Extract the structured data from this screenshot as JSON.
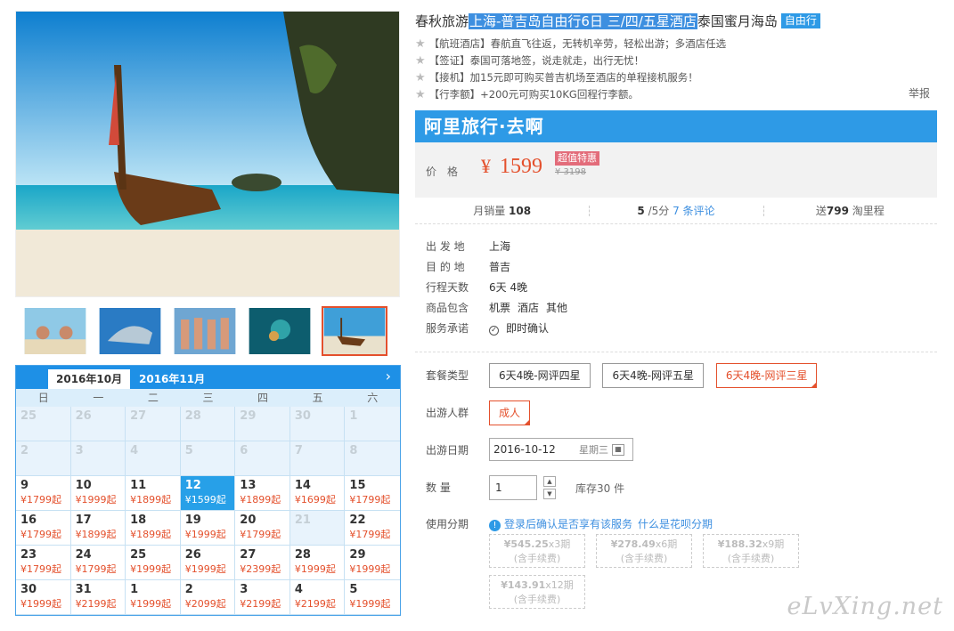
{
  "title": {
    "prefix": "春秋旅游",
    "highlight": "上海-普吉岛自由行6日 三/四/五星酒店",
    "suffix": "泰国蜜月海岛",
    "tag": "自由行"
  },
  "features": [
    "【航班酒店】春航直飞往返，无转机辛劳，轻松出游；多酒店任选",
    "【签证】泰国可落地签，说走就走，出行无忧！",
    "【接机】加15元即可购买普吉机场至酒店的单程接机服务！",
    "【行李额】+200元可购买10KG回程行李额。"
  ],
  "report_label": "举报",
  "brand": "阿里旅行·去啊",
  "price": {
    "label": "价格",
    "currency": "¥",
    "value": "1599",
    "badge": "超值特惠",
    "original": "¥ 3198"
  },
  "stats": {
    "sales_label": "月销量",
    "sales_value": "108",
    "rating_value": "5",
    "rating_suffix": "/5分",
    "reviews_link": "7 条评论",
    "miles_prefix": "送",
    "miles_value": "799",
    "miles_suffix": "淘里程"
  },
  "info": [
    {
      "key": "出 发 地",
      "value": "上海"
    },
    {
      "key": "目 的 地",
      "value": "普吉"
    },
    {
      "key": "行程天数",
      "value": "6天 4晚"
    },
    {
      "key": "商品包含",
      "values": [
        "机票",
        "酒店",
        "其他"
      ]
    },
    {
      "key": "服务承诺",
      "value": "即时确认"
    }
  ],
  "options": {
    "package_label": "套餐类型",
    "packages": [
      "6天4晚-网评四星",
      "6天4晚-网评五星",
      "6天4晚-网评三星"
    ],
    "traveler_label": "出游人群",
    "traveler": "成人",
    "date_label": "出游日期",
    "date_value": "2016-10-12",
    "date_weekday": "星期三",
    "qty_label": "数 量",
    "qty_value": "1",
    "stock": "库存30 件",
    "installment_label": "使用分期",
    "installment_note": "登录后确认是否享有该服务",
    "installment_link": "什么是花呗分期",
    "installments": [
      {
        "amount": "¥545.25",
        "period": "x3期",
        "fee": "(含手续费)"
      },
      {
        "amount": "¥278.49",
        "period": "x6期",
        "fee": "(含手续费)"
      },
      {
        "amount": "¥188.32",
        "period": "x9期",
        "fee": "(含手续费)"
      },
      {
        "amount": "¥143.91",
        "period": "x12期",
        "fee": "(含手续费)"
      }
    ]
  },
  "calendar": {
    "tab_active": "2016年10月",
    "tab_other": "2016年11月",
    "weekdays": [
      "日",
      "一",
      "二",
      "三",
      "四",
      "五",
      "六"
    ],
    "cells": [
      {
        "d": "25",
        "p": "",
        "muted": true
      },
      {
        "d": "26",
        "p": "",
        "muted": true
      },
      {
        "d": "27",
        "p": "",
        "muted": true
      },
      {
        "d": "28",
        "p": "",
        "muted": true
      },
      {
        "d": "29",
        "p": "",
        "muted": true
      },
      {
        "d": "30",
        "p": "",
        "muted": true
      },
      {
        "d": "1",
        "p": "",
        "muted": true
      },
      {
        "d": "2",
        "p": "",
        "muted": true
      },
      {
        "d": "3",
        "p": "",
        "muted": true
      },
      {
        "d": "4",
        "p": "",
        "muted": true
      },
      {
        "d": "5",
        "p": "",
        "muted": true
      },
      {
        "d": "6",
        "p": "",
        "muted": true
      },
      {
        "d": "7",
        "p": "",
        "muted": true
      },
      {
        "d": "8",
        "p": "",
        "muted": true
      },
      {
        "d": "9",
        "p": "¥1799起"
      },
      {
        "d": "10",
        "p": "¥1999起"
      },
      {
        "d": "11",
        "p": "¥1899起"
      },
      {
        "d": "12",
        "p": "¥1599起",
        "sel": true
      },
      {
        "d": "13",
        "p": "¥1899起"
      },
      {
        "d": "14",
        "p": "¥1699起"
      },
      {
        "d": "15",
        "p": "¥1799起"
      },
      {
        "d": "16",
        "p": "¥1799起"
      },
      {
        "d": "17",
        "p": "¥1899起"
      },
      {
        "d": "18",
        "p": "¥1899起"
      },
      {
        "d": "19",
        "p": "¥1999起"
      },
      {
        "d": "20",
        "p": "¥1799起"
      },
      {
        "d": "21",
        "p": "",
        "muted": true
      },
      {
        "d": "22",
        "p": "¥1799起"
      },
      {
        "d": "23",
        "p": "¥1799起"
      },
      {
        "d": "24",
        "p": "¥1799起"
      },
      {
        "d": "25",
        "p": "¥1999起"
      },
      {
        "d": "26",
        "p": "¥1999起"
      },
      {
        "d": "27",
        "p": "¥2399起"
      },
      {
        "d": "28",
        "p": "¥1999起"
      },
      {
        "d": "29",
        "p": "¥1999起"
      },
      {
        "d": "30",
        "p": "¥1999起"
      },
      {
        "d": "31",
        "p": "¥2199起"
      },
      {
        "d": "1",
        "p": "¥1999起"
      },
      {
        "d": "2",
        "p": "¥2099起"
      },
      {
        "d": "3",
        "p": "¥2199起"
      },
      {
        "d": "4",
        "p": "¥2199起"
      },
      {
        "d": "5",
        "p": "¥1999起"
      }
    ]
  },
  "watermark": "eLvXing.net"
}
